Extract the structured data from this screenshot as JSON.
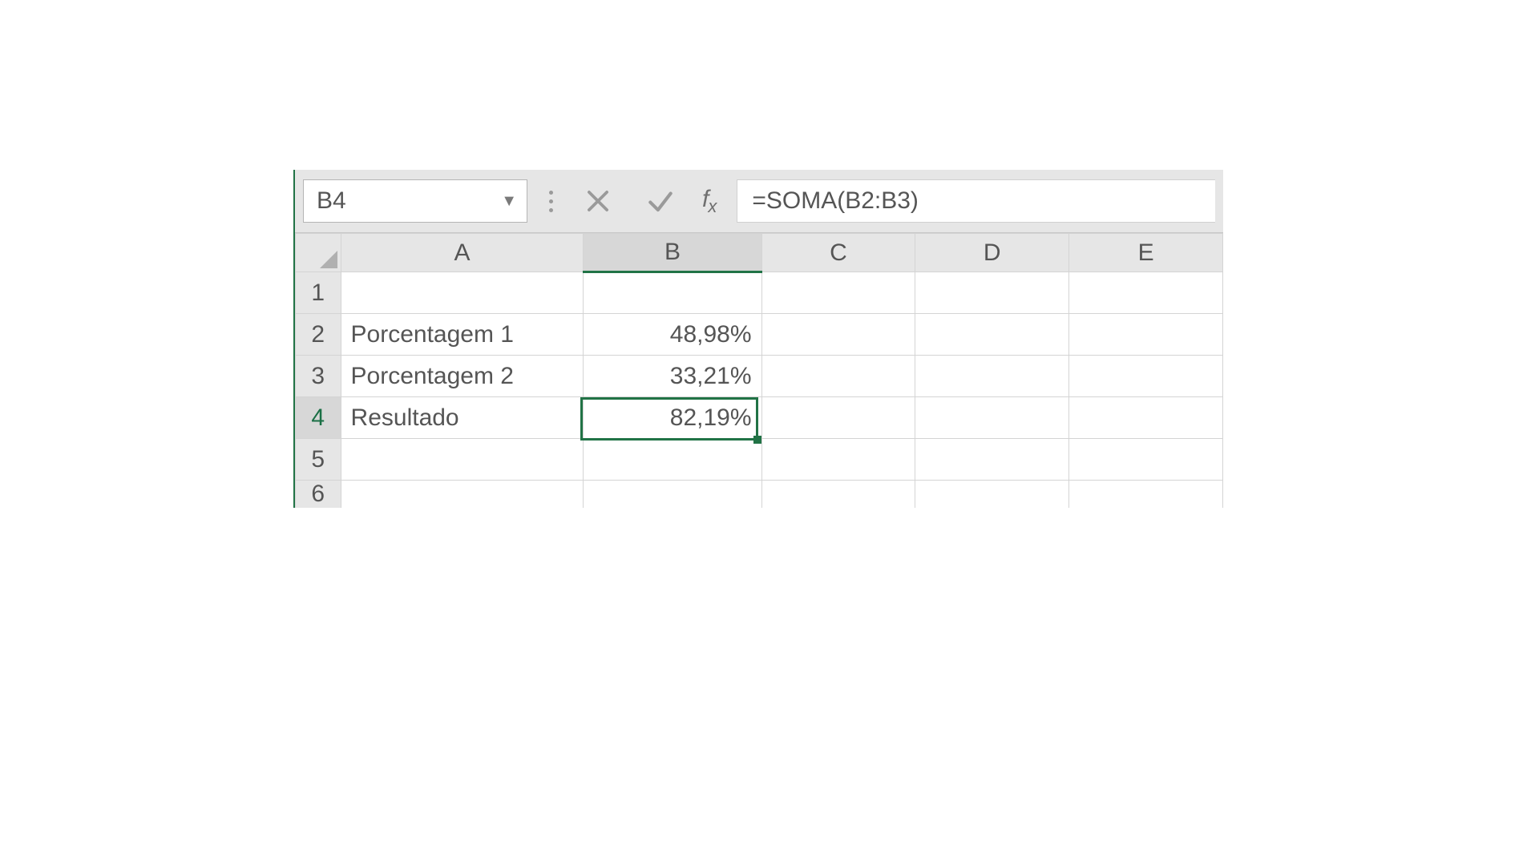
{
  "name_box": {
    "value": "B4"
  },
  "formula_bar": {
    "value": "=SOMA(B2:B3)"
  },
  "columns": [
    "A",
    "B",
    "C",
    "D",
    "E"
  ],
  "rows": [
    {
      "num": "1",
      "A": "",
      "B": ""
    },
    {
      "num": "2",
      "A": "Porcentagem 1",
      "B": "48,98%"
    },
    {
      "num": "3",
      "A": "Porcentagem 2",
      "B": "33,21%"
    },
    {
      "num": "4",
      "A": "Resultado",
      "B": "82,19%"
    },
    {
      "num": "5",
      "A": "",
      "B": ""
    },
    {
      "num": "6",
      "A": "",
      "B": ""
    }
  ],
  "selection": {
    "cell": "B4",
    "row": 4,
    "col": "B"
  },
  "colors": {
    "excel_green": "#217346"
  }
}
